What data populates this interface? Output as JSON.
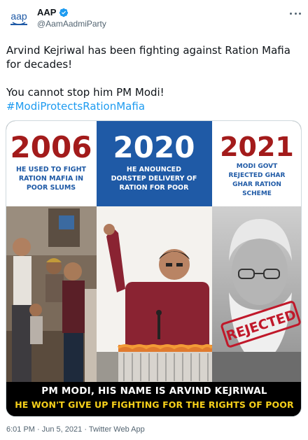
{
  "author": {
    "display_name": "AAP",
    "handle": "@AamAadmiParty",
    "avatar_text": "aap",
    "verified": true
  },
  "tweet": {
    "line1": "Arvind Kejriwal has been fighting against Ration Mafia for decades!",
    "line2": "You cannot stop him PM Modi!",
    "hashtag": "#ModiProtectsRationMafia"
  },
  "media": {
    "panels": [
      {
        "year": "2006",
        "caption_line1": "HE USED TO FIGHT",
        "caption_line2": "RATION MAFIA IN",
        "caption_line3": "POOR SLUMS",
        "year_color": "#a31b1b"
      },
      {
        "year": "2020",
        "caption_line1": "HE ANOUNCED",
        "caption_line2": "DORSTEP DELIVERY OF",
        "caption_line3": "RATION FOR POOR",
        "year_color": "#ffffff"
      },
      {
        "year": "2021",
        "caption_line1": "MODI GOVT",
        "caption_line2": "REJECTED GHAR",
        "caption_line3": "GHAR RATION",
        "caption_line4": "SCHEME",
        "year_color": "#a31b1b"
      }
    ],
    "stamp": "REJECTED",
    "bottom_line1": "PM MODI, HIS NAME IS ARVIND KEJRIWAL",
    "bottom_line2": "HE WON'T GIVE UP FIGHTING FOR THE RIGHTS OF POOR"
  },
  "meta": {
    "time": "6:01 PM",
    "separator": "·",
    "date": "Jun 5, 2021",
    "source": "Twitter Web App"
  },
  "colors": {
    "accent_blue": "#1d9bf0",
    "panel_blue": "#1f5aa6",
    "year_red": "#a31b1b",
    "caption_blue": "#1f5aa6",
    "caption_yellow": "#f5cf1a"
  }
}
